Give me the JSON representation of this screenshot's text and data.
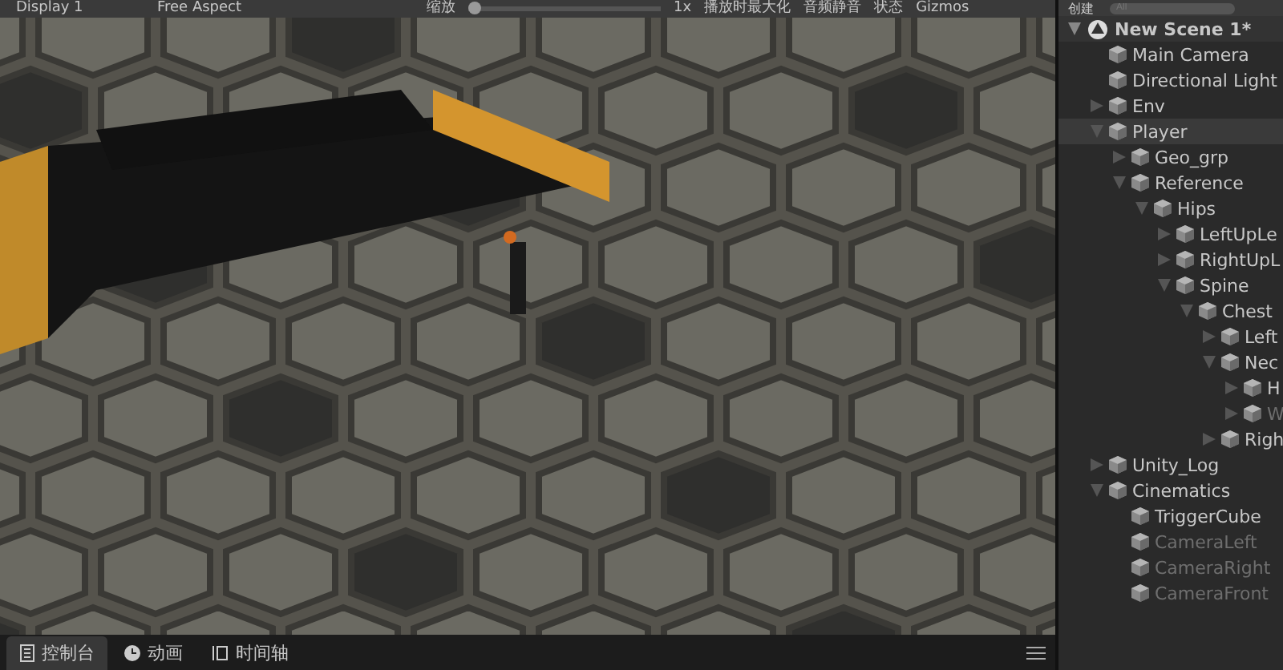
{
  "game_toolbar": {
    "display": "Display 1",
    "aspect": "Free Aspect",
    "scale_label": "缩放",
    "scale": {
      "level": 0.0
    },
    "scale_value": "1x",
    "toggles": [
      "播放时最大化",
      "音频静音",
      "状态",
      "Gizmos"
    ]
  },
  "hierarchy": {
    "create": "创建",
    "search": {
      "placeholder": "All"
    },
    "scene": {
      "name": "New Scene 1*",
      "expanded": true
    },
    "items": [
      {
        "name": "Main Camera",
        "selected": false,
        "disabled": false
      },
      {
        "name": "Directional Light",
        "selected": false,
        "disabled": false
      },
      {
        "name": "Env",
        "selected": false,
        "disabled": false,
        "expanded": false
      },
      {
        "name": "Player",
        "selected": true,
        "disabled": false,
        "expanded": true,
        "children": [
          {
            "name": "Geo_grp",
            "selected": false,
            "disabled": false,
            "expanded": false
          },
          {
            "name": "Reference",
            "selected": false,
            "disabled": false,
            "expanded": true,
            "children": [
              {
                "name": "Hips",
                "selected": false,
                "disabled": false,
                "expanded": true,
                "children": [
                  {
                    "name": "LeftUpLe",
                    "selected": false,
                    "disabled": false,
                    "expanded": false
                  },
                  {
                    "name": "RightUpL",
                    "selected": false,
                    "disabled": false,
                    "expanded": false
                  },
                  {
                    "name": "Spine",
                    "selected": false,
                    "disabled": false,
                    "expanded": true,
                    "children": [
                      {
                        "name": "Chest",
                        "selected": false,
                        "disabled": false,
                        "expanded": true,
                        "children": [
                          {
                            "name": "Left",
                            "selected": false,
                            "disabled": false,
                            "expanded": false
                          },
                          {
                            "name": "Nec",
                            "selected": false,
                            "disabled": false,
                            "expanded": true,
                            "children": [
                              {
                                "name": "H",
                                "selected": false,
                                "disabled": false,
                                "expanded": false
                              },
                              {
                                "name": "W",
                                "selected": false,
                                "disabled": true,
                                "expanded": false
                              }
                            ]
                          },
                          {
                            "name": "Righ",
                            "selected": false,
                            "disabled": false,
                            "expanded": false
                          }
                        ]
                      }
                    ]
                  }
                ]
              }
            ]
          }
        ]
      },
      {
        "name": "Unity_Log",
        "selected": false,
        "disabled": false,
        "expanded": false
      },
      {
        "name": "Cinematics",
        "selected": false,
        "disabled": false,
        "expanded": true,
        "children": [
          {
            "name": "TriggerCube",
            "selected": false,
            "disabled": false
          },
          {
            "name": "CameraLeft",
            "selected": false,
            "disabled": true
          },
          {
            "name": "CameraRight",
            "selected": false,
            "disabled": true
          },
          {
            "name": "CameraFront",
            "selected": false,
            "disabled": true
          }
        ]
      }
    ]
  },
  "bottom_tabs": [
    {
      "label": "控制台",
      "kind": "console",
      "selected": true
    },
    {
      "label": "动画",
      "kind": "animation",
      "selected": false
    },
    {
      "label": "时间轴",
      "kind": "timeline",
      "selected": false
    }
  ]
}
